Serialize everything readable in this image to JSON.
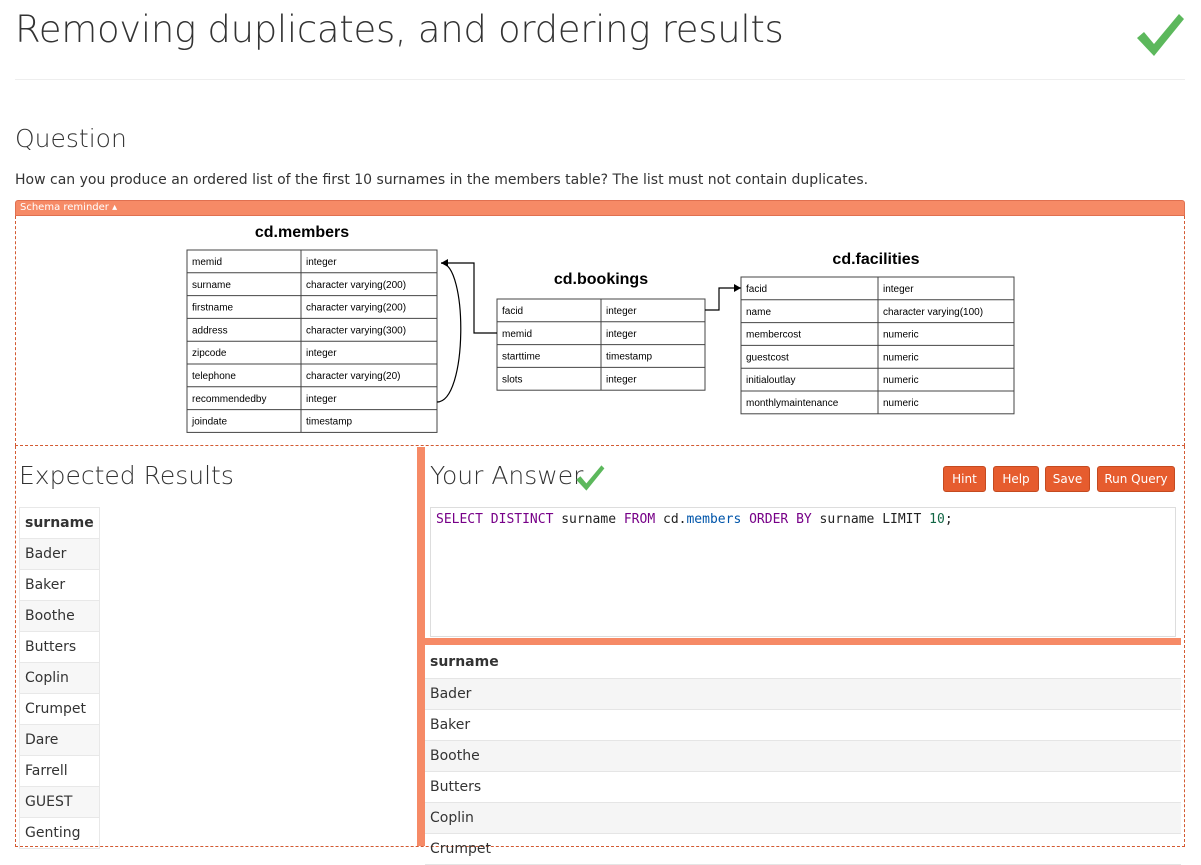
{
  "page": {
    "title": "Removing duplicates, and ordering results",
    "question_heading": "Question",
    "question_text": "How can you produce an ordered list of the first 10 surnames in the members table? The list must not contain duplicates.",
    "schema_toggle_label": "Schema reminder ▴"
  },
  "schema": {
    "members": {
      "name": "cd.members",
      "columns": [
        {
          "col": "memid",
          "type": "integer"
        },
        {
          "col": "surname",
          "type": "character varying(200)"
        },
        {
          "col": "firstname",
          "type": "character varying(200)"
        },
        {
          "col": "address",
          "type": "character varying(300)"
        },
        {
          "col": "zipcode",
          "type": "integer"
        },
        {
          "col": "telephone",
          "type": "character varying(20)"
        },
        {
          "col": "recommendedby",
          "type": "integer"
        },
        {
          "col": "joindate",
          "type": "timestamp"
        }
      ]
    },
    "bookings": {
      "name": "cd.bookings",
      "columns": [
        {
          "col": "facid",
          "type": "integer"
        },
        {
          "col": "memid",
          "type": "integer"
        },
        {
          "col": "starttime",
          "type": "timestamp"
        },
        {
          "col": "slots",
          "type": "integer"
        }
      ]
    },
    "facilities": {
      "name": "cd.facilities",
      "columns": [
        {
          "col": "facid",
          "type": "integer"
        },
        {
          "col": "name",
          "type": "character varying(100)"
        },
        {
          "col": "membercost",
          "type": "numeric"
        },
        {
          "col": "guestcost",
          "type": "numeric"
        },
        {
          "col": "initialoutlay",
          "type": "numeric"
        },
        {
          "col": "monthlymaintenance",
          "type": "numeric"
        }
      ]
    }
  },
  "expected": {
    "heading": "Expected Results",
    "column": "surname",
    "rows": [
      "Bader",
      "Baker",
      "Boothe",
      "Butters",
      "Coplin",
      "Crumpet",
      "Dare",
      "Farrell",
      "GUEST",
      "Genting"
    ]
  },
  "answer": {
    "heading": "Your Answer",
    "buttons": {
      "hint": "Hint",
      "help": "Help",
      "save": "Save",
      "run": "Run Query"
    },
    "query_tokens": {
      "select": "SELECT DISTINCT",
      "col": " surname ",
      "from": "FROM",
      "schema": " cd.",
      "table": "members",
      "order": "ORDER BY",
      "order_col": " surname ",
      "limit": "LIMIT ",
      "limit_val": "10",
      "end": ";"
    }
  },
  "results": {
    "column": "surname",
    "rows": [
      "Bader",
      "Baker",
      "Boothe",
      "Butters",
      "Coplin",
      "Crumpet"
    ]
  },
  "colors": {
    "accent": "#f68a66",
    "button": "#e65c2e",
    "check": "#5cb85c"
  }
}
